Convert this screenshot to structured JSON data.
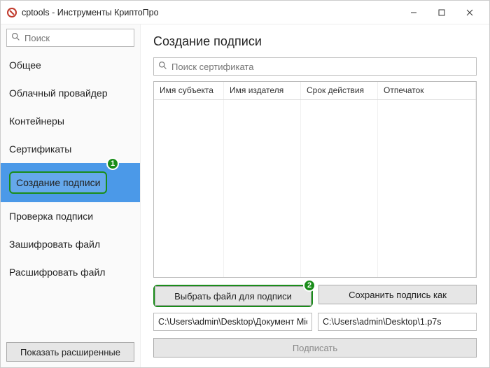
{
  "titlebar": {
    "title": "cptools - Инструменты КриптоПро"
  },
  "sidebar": {
    "search_placeholder": "Поиск",
    "items": [
      {
        "label": "Общее"
      },
      {
        "label": "Облачный провайдер"
      },
      {
        "label": "Контейнеры"
      },
      {
        "label": "Сертификаты"
      },
      {
        "label": "Создание подписи"
      },
      {
        "label": "Проверка подписи"
      },
      {
        "label": "Зашифровать файл"
      },
      {
        "label": "Расшифровать файл"
      }
    ],
    "show_advanced_label": "Показать расширенные"
  },
  "main": {
    "heading": "Создание подписи",
    "cert_search_placeholder": "Поиск сертификата",
    "columns": {
      "subject": "Имя субъекта",
      "issuer": "Имя издателя",
      "validity": "Срок действия",
      "thumbprint": "Отпечаток"
    },
    "choose_file_label": "Выбрать файл для подписи",
    "save_sig_label": "Сохранить подпись как",
    "input_path": "C:\\Users\\admin\\Desktop\\Документ Mic",
    "output_path": "C:\\Users\\admin\\Desktop\\1.p7s",
    "sign_label": "Подписать"
  },
  "annotations": {
    "step1": "1",
    "step2": "2"
  }
}
